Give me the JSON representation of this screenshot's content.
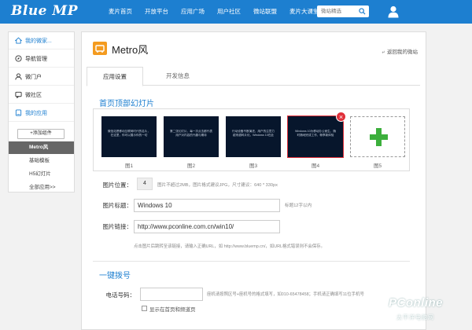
{
  "header": {
    "logo": "Blue MP",
    "nav": [
      "麦片首页",
      "开放平台",
      "应用广场",
      "用户社区",
      "微站联盟",
      "麦片大课堂"
    ],
    "search_placeholder": "微站精选"
  },
  "sidebar": {
    "items": [
      {
        "label": "我的微家...",
        "icon": "home-icon"
      },
      {
        "label": "导航管理",
        "icon": "compass-icon"
      },
      {
        "label": "微门户",
        "icon": "user-icon"
      },
      {
        "label": "微社区",
        "icon": "forum-icon"
      },
      {
        "label": "我的应用",
        "icon": "app-icon"
      }
    ],
    "add_component": "+添加组件",
    "sub_items": [
      "Metro风",
      "基础模板",
      "H5幻灯片",
      "全部应用>>"
    ],
    "active_sub": "Metro风"
  },
  "main": {
    "title": "Metro风",
    "back_link": "返回我的微站",
    "tabs": [
      "应用设置",
      "开发信息"
    ],
    "active_tab": "应用设置",
    "slides_section": "首页顶部幻灯片",
    "slides": [
      {
        "label": "图1",
        "text": "微信站是移动互联网时代的名片，在这里，你可以展示你的一切"
      },
      {
        "label": "图2",
        "text": "第二张幻灯片，每一次点击都代表用户对内容的兴趣与期待"
      },
      {
        "label": "图3",
        "text": "行动设备不断演进，用户的注意力越来越碎片化，Windows 10在此"
      },
      {
        "label": "图4",
        "text": "Windows 10为移动办公而生，随时随地完成工作，畅享新体验"
      }
    ],
    "add_slide_label": "图5",
    "pic_position_label": "图片位置：",
    "pic_position_value": "4",
    "pic_position_hint": "图片不超过2MB，图片格式建议JPG，尺寸建议：640 * 330px",
    "pic_title_label": "图片标题：",
    "pic_title_value": "Windows 10",
    "pic_title_hint": "标题12字以内",
    "pic_link_label": "图片链接：",
    "pic_link_value": "http://www.pconline.com.cn/win10/",
    "pic_link_hint": "点击图片后跳转至该链接，请输入正确URL，如 http://www.bluemp.cn/，如URL格式错误则不会保存。",
    "call_section": "一键拨号",
    "phone_label": "电话号码：",
    "phone_hint": "座机请按照区号+座机号的格式填写，如010-65478458；手机请正确填写11位手机号",
    "show_on_home_label": "显示在首页和频道页"
  },
  "watermark": {
    "text": "PConline",
    "sub": "太平洋电脑网"
  },
  "colors": {
    "brand_blue": "#1d7fd0",
    "accent_orange": "#f49b1f",
    "plus_green": "#3caf3c",
    "close_red": "#e0303a"
  }
}
